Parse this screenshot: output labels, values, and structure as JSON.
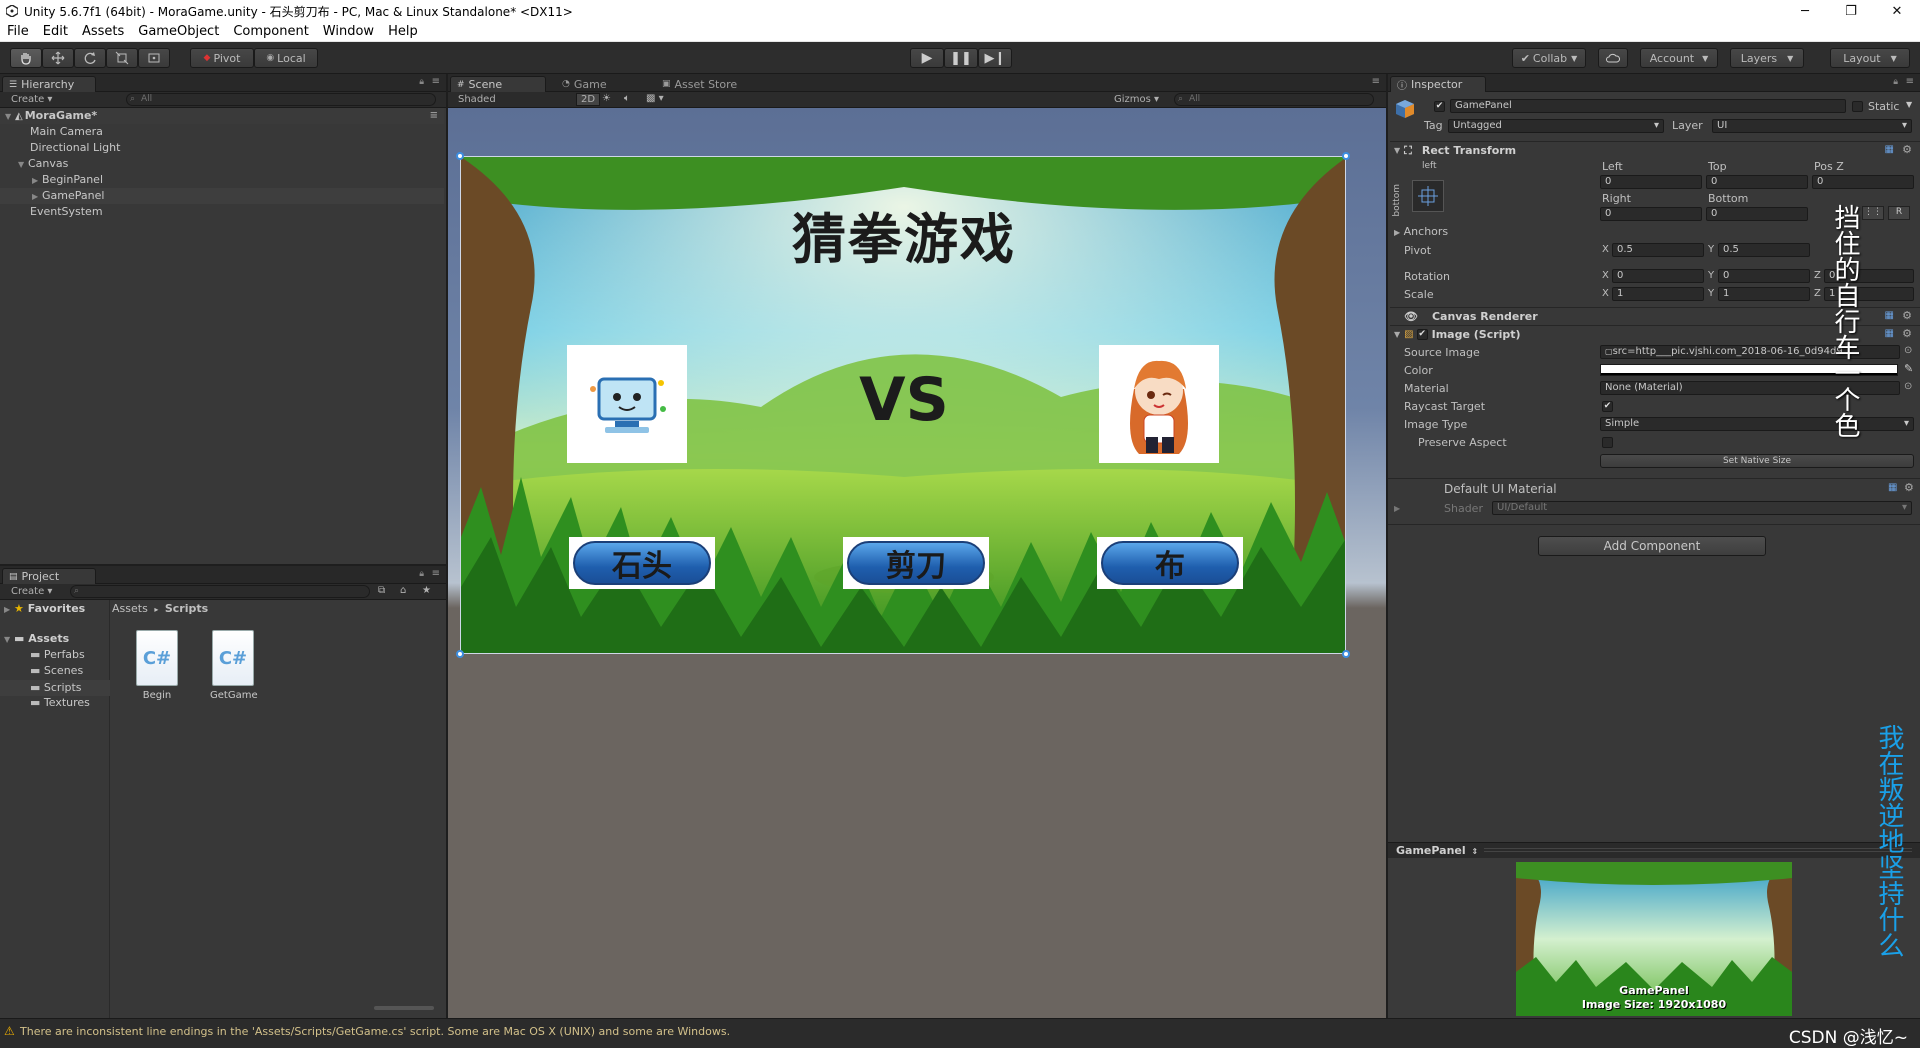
{
  "window": {
    "title": "Unity 5.6.7f1 (64bit) - MoraGame.unity - 石头剪刀布 - PC, Mac & Linux Standalone* <DX11>",
    "controls": [
      "─",
      "❐",
      "✕"
    ]
  },
  "menu": [
    "File",
    "Edit",
    "Assets",
    "GameObject",
    "Component",
    "Window",
    "Help"
  ],
  "toolbar": {
    "pivot": "Pivot",
    "local": "Local",
    "collab": "Collab",
    "account": "Account",
    "layers": "Layers",
    "layout": "Layout"
  },
  "hierarchy": {
    "tab": "Hierarchy",
    "create": "Create",
    "search_placeholder": "All",
    "scene": "MoraGame*",
    "items": [
      "Main Camera",
      "Directional Light",
      "Canvas",
      "BeginPanel",
      "GamePanel",
      "EventSystem"
    ]
  },
  "scene_tabs": {
    "scene": "Scene",
    "game": "Game",
    "store": "Asset Store",
    "shading": "Shaded",
    "mode2d": "2D",
    "gizmos": "Gizmos",
    "search_placeholder": "All"
  },
  "game_view": {
    "title": "猜拳游戏",
    "vs": "VS",
    "buttons": [
      "石头",
      "剪刀",
      "布"
    ]
  },
  "project": {
    "tab": "Project",
    "create": "Create",
    "favorites": "Favorites",
    "breadcrumb_root": "Assets",
    "breadcrumb_leaf": "Scripts",
    "assets_label": "Assets",
    "folders": [
      "Perfabs",
      "Scenes",
      "Scripts",
      "Textures"
    ],
    "files": [
      "Begin",
      "GetGame"
    ],
    "file_icon_text": "C#"
  },
  "inspector": {
    "tab": "Inspector",
    "object_name": "GamePanel",
    "static_label": "Static",
    "tag_label": "Tag",
    "tag_value": "Untagged",
    "layer_label": "Layer",
    "layer_value": "UI",
    "rect_transform": "Rect Transform",
    "anchor_preset_top": "left",
    "anchor_preset_side": "bottom",
    "left_label": "Left",
    "left_value": "0",
    "top_label": "Top",
    "top_value": "0",
    "posz_label": "Pos Z",
    "posz_value": "0",
    "right_label": "Right",
    "right_value": "0",
    "bottom_label": "Bottom",
    "bottom_value": "0",
    "anchors": "Anchors",
    "pivot_label": "Pivot",
    "pivot_x": "0.5",
    "pivot_y": "0.5",
    "rotation_label": "Rotation",
    "rot_x": "0",
    "rot_y": "0",
    "rot_z": "0",
    "scale_label": "Scale",
    "scale_x": "1",
    "scale_y": "1",
    "scale_z": "1",
    "axis_x": "X",
    "axis_y": "Y",
    "axis_z": "Z",
    "canvas_renderer": "Canvas Renderer",
    "image_script": "Image (Script)",
    "source_image_label": "Source Image",
    "source_image_value": "src=http___pic.vjshi.com_2018-06-16_0d94d9",
    "color_label": "Color",
    "material_label": "Material",
    "material_value": "None (Material)",
    "raycast_label": "Raycast Target",
    "image_type_label": "Image Type",
    "image_type_value": "Simple",
    "preserve_label": "Preserve Aspect",
    "set_native": "Set Native Size",
    "default_material": "Default UI Material",
    "shader_label": "Shader",
    "shader_value": "UI/Default",
    "add_component": "Add Component",
    "preview_title": "GamePanel",
    "preview_name": "GamePanel",
    "preview_size": "Image Size: 1920x1080"
  },
  "overlay": {
    "text1": "挡住的自行车一个色",
    "text2": "我在叛逆地坚持什么",
    "watermark": "CSDN @浅忆~"
  },
  "status": {
    "message": "There are inconsistent line endings in the 'Assets/Scripts/GetGame.cs' script. Some are Mac OS X (UNIX) and some are Windows."
  },
  "colors": {
    "panel": "#383838",
    "dark": "#282828",
    "selection": "#3e3e3e",
    "accent_blue": "#3d8ee0",
    "overlay_text": "#1aa0e8",
    "warning": "#f0b000"
  }
}
